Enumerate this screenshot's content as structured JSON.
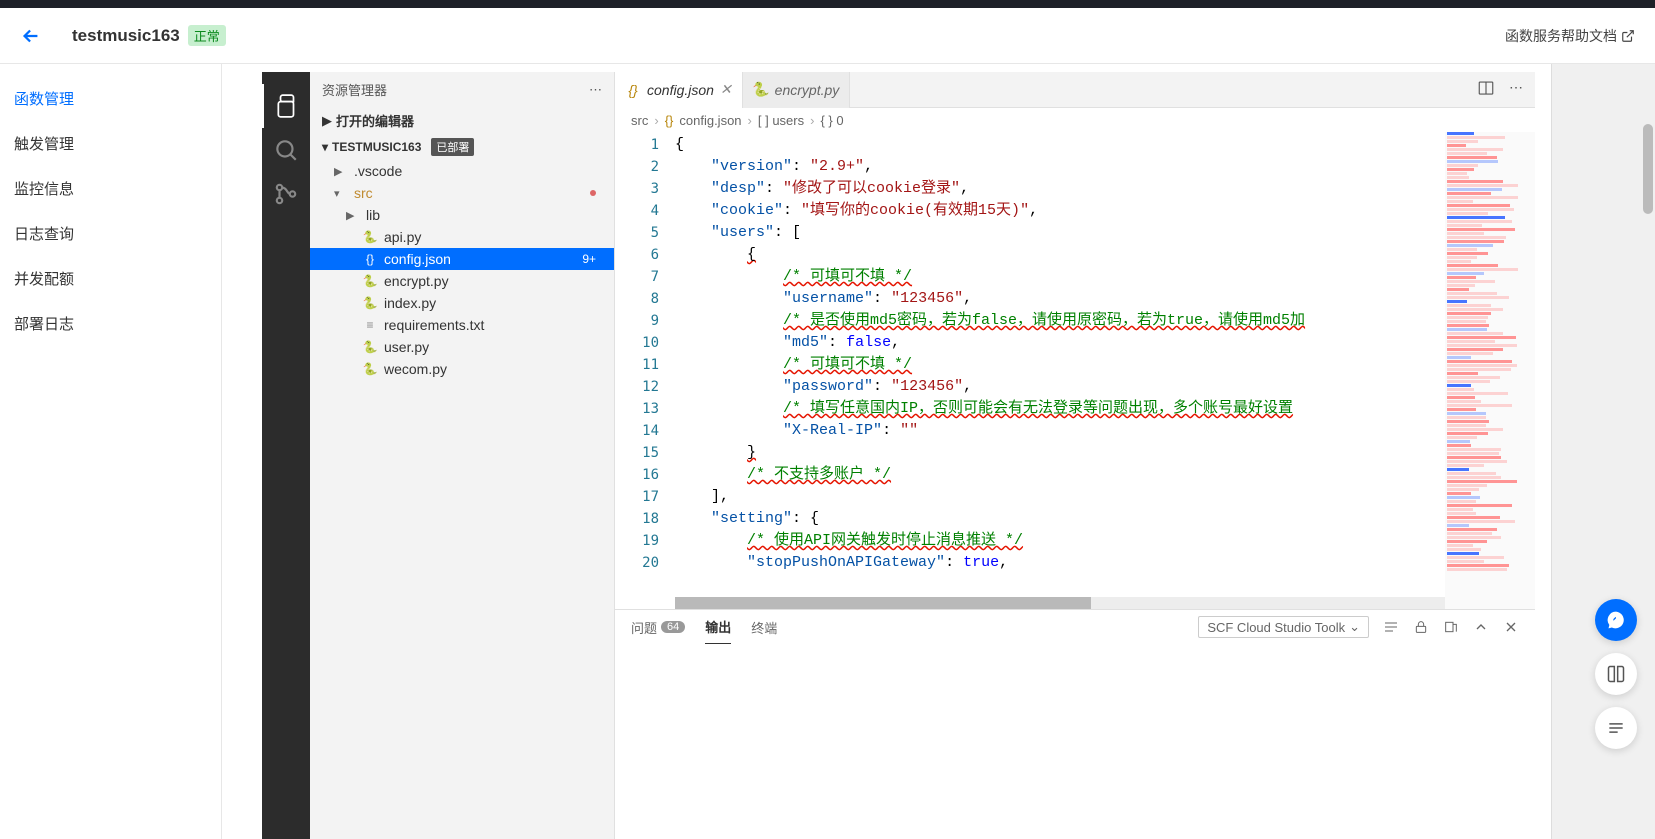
{
  "header": {
    "title": "testmusic163",
    "status": "正常",
    "help_link": "函数服务帮助文档"
  },
  "left_nav": {
    "items": [
      "函数管理",
      "触发管理",
      "监控信息",
      "日志查询",
      "并发配额",
      "部署日志"
    ],
    "active_index": 0
  },
  "explorer": {
    "title": "资源管理器",
    "open_editors": "打开的编辑器",
    "project_name": "TESTMUSIC163",
    "deployed_tag": "已部署",
    "tree": {
      "vscode": ".vscode",
      "src": "src",
      "lib": "lib",
      "files": [
        "api.py",
        "config.json",
        "encrypt.py",
        "index.py",
        "requirements.txt",
        "user.py",
        "wecom.py"
      ],
      "selected": "config.json",
      "selected_badge": "9+"
    }
  },
  "tabs": {
    "items": [
      {
        "name": "config.json",
        "icon": "json",
        "active": true,
        "modified": true
      },
      {
        "name": "encrypt.py",
        "icon": "py",
        "active": false,
        "modified": false
      }
    ]
  },
  "breadcrumb": {
    "parts": [
      "src",
      "config.json",
      "[ ] users",
      "{ } 0"
    ]
  },
  "code": {
    "lines": [
      {
        "n": 1,
        "t": [
          {
            "c": "s-pun",
            "v": "{"
          }
        ]
      },
      {
        "n": 2,
        "t": [
          {
            "c": "",
            "v": "    "
          },
          {
            "c": "s-key",
            "v": "\"version\""
          },
          {
            "c": "s-pun",
            "v": ": "
          },
          {
            "c": "s-str",
            "v": "\"2.9+\""
          },
          {
            "c": "s-pun",
            "v": ","
          }
        ]
      },
      {
        "n": 3,
        "t": [
          {
            "c": "",
            "v": "    "
          },
          {
            "c": "s-key",
            "v": "\"desp\""
          },
          {
            "c": "s-pun",
            "v": ": "
          },
          {
            "c": "s-str",
            "v": "\"修改了可以cookie登录\""
          },
          {
            "c": "s-pun",
            "v": ","
          }
        ]
      },
      {
        "n": 4,
        "t": [
          {
            "c": "",
            "v": "    "
          },
          {
            "c": "s-key",
            "v": "\"cookie\""
          },
          {
            "c": "s-pun",
            "v": ": "
          },
          {
            "c": "s-str",
            "v": "\"填写你的cookie(有效期15天)\""
          },
          {
            "c": "s-pun",
            "v": ","
          }
        ]
      },
      {
        "n": 5,
        "t": [
          {
            "c": "",
            "v": "    "
          },
          {
            "c": "s-key",
            "v": "\"users\""
          },
          {
            "c": "s-pun",
            "v": ": ["
          }
        ]
      },
      {
        "n": 6,
        "t": [
          {
            "c": "",
            "v": "        "
          },
          {
            "c": "s-pun wavy",
            "v": "{"
          }
        ]
      },
      {
        "n": 7,
        "t": [
          {
            "c": "",
            "v": "            "
          },
          {
            "c": "s-cmt wavy",
            "v": "/* 可填可不填 */"
          }
        ]
      },
      {
        "n": 8,
        "t": [
          {
            "c": "",
            "v": "            "
          },
          {
            "c": "s-key",
            "v": "\"username\""
          },
          {
            "c": "s-pun",
            "v": ": "
          },
          {
            "c": "s-str",
            "v": "\"123456\""
          },
          {
            "c": "s-pun",
            "v": ","
          }
        ]
      },
      {
        "n": 9,
        "t": [
          {
            "c": "",
            "v": "            "
          },
          {
            "c": "s-cmt wavy",
            "v": "/* 是否使用md5密码，若为false，请使用原密码，若为true，请使用md5加"
          }
        ]
      },
      {
        "n": 10,
        "t": [
          {
            "c": "",
            "v": "            "
          },
          {
            "c": "s-key",
            "v": "\"md5\""
          },
          {
            "c": "s-pun",
            "v": ": "
          },
          {
            "c": "s-kw",
            "v": "false"
          },
          {
            "c": "s-pun",
            "v": ","
          }
        ]
      },
      {
        "n": 11,
        "t": [
          {
            "c": "",
            "v": "            "
          },
          {
            "c": "s-cmt wavy",
            "v": "/* 可填可不填 */"
          }
        ]
      },
      {
        "n": 12,
        "t": [
          {
            "c": "",
            "v": "            "
          },
          {
            "c": "s-key",
            "v": "\"password\""
          },
          {
            "c": "s-pun",
            "v": ": "
          },
          {
            "c": "s-str",
            "v": "\"123456\""
          },
          {
            "c": "s-pun",
            "v": ","
          }
        ]
      },
      {
        "n": 13,
        "t": [
          {
            "c": "",
            "v": "            "
          },
          {
            "c": "s-cmt wavy",
            "v": "/* 填写任意国内IP，否则可能会有无法登录等问题出现，多个账号最好设置"
          }
        ]
      },
      {
        "n": 14,
        "t": [
          {
            "c": "",
            "v": "            "
          },
          {
            "c": "s-key",
            "v": "\"X-Real-IP\""
          },
          {
            "c": "s-pun",
            "v": ": "
          },
          {
            "c": "s-str",
            "v": "\"\""
          }
        ]
      },
      {
        "n": 15,
        "t": [
          {
            "c": "",
            "v": "        "
          },
          {
            "c": "s-pun wavy",
            "v": "}"
          }
        ]
      },
      {
        "n": 16,
        "t": [
          {
            "c": "",
            "v": "        "
          },
          {
            "c": "s-cmt wavy",
            "v": "/* 不支持多账户 */"
          }
        ]
      },
      {
        "n": 17,
        "t": [
          {
            "c": "",
            "v": "    "
          },
          {
            "c": "s-pun",
            "v": "],"
          }
        ]
      },
      {
        "n": 18,
        "t": [
          {
            "c": "",
            "v": "    "
          },
          {
            "c": "s-key",
            "v": "\"setting\""
          },
          {
            "c": "s-pun",
            "v": ": {"
          }
        ]
      },
      {
        "n": 19,
        "t": [
          {
            "c": "",
            "v": "        "
          },
          {
            "c": "s-cmt wavy",
            "v": "/* 使用API网关触发时停止消息推送 */"
          }
        ]
      },
      {
        "n": 20,
        "t": [
          {
            "c": "",
            "v": "        "
          },
          {
            "c": "s-key",
            "v": "\"stopPushOnAPIGateway\""
          },
          {
            "c": "s-pun",
            "v": ": "
          },
          {
            "c": "s-kw",
            "v": "true"
          },
          {
            "c": "s-pun",
            "v": ","
          }
        ]
      }
    ]
  },
  "panel": {
    "tabs": {
      "problems": "问题",
      "problems_count": "64",
      "output": "输出",
      "terminal": "终端"
    },
    "dropdown": "SCF Cloud Studio Toolk"
  }
}
